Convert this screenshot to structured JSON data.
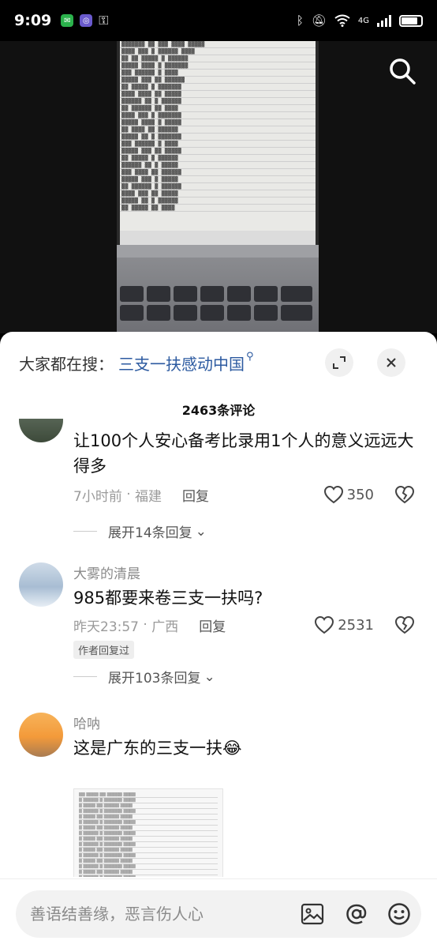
{
  "status_bar": {
    "time": "9:09",
    "network_label": "4G"
  },
  "search_hint": {
    "label": "大家都在搜：",
    "term": "三支一扶感动中国"
  },
  "comments_header": {
    "count_label": "2463条评论"
  },
  "comments": [
    {
      "text": "让100个人安心备考比录用1个人的意义远远大得多",
      "time": "7小时前",
      "location": "福建",
      "reply_label": "回复",
      "likes": "350",
      "expand_label": "展开14条回复"
    },
    {
      "user": "大雾的清晨",
      "text": "985都要来卷三支一扶吗?",
      "time": "昨天23:57",
      "location": "广西",
      "reply_label": "回复",
      "likes": "2531",
      "author_badge": "作者回复过",
      "expand_label": "展开103条回复"
    },
    {
      "user": "哈呐",
      "text": "这是广东的三支一扶",
      "emoji": "😂"
    }
  ],
  "input_bar": {
    "placeholder": "善语结善缘，恶言伤人心"
  },
  "icons": {
    "video_search": "search-icon",
    "expand": "expand-icon",
    "close": "close-icon",
    "like": "heart-icon",
    "dislike": "broken-heart-icon",
    "image": "image-icon",
    "mention": "at-icon",
    "emoji": "smiley-icon"
  },
  "colors": {
    "search_term": "#2c5aa0",
    "sheet_background": "#ffffff"
  }
}
